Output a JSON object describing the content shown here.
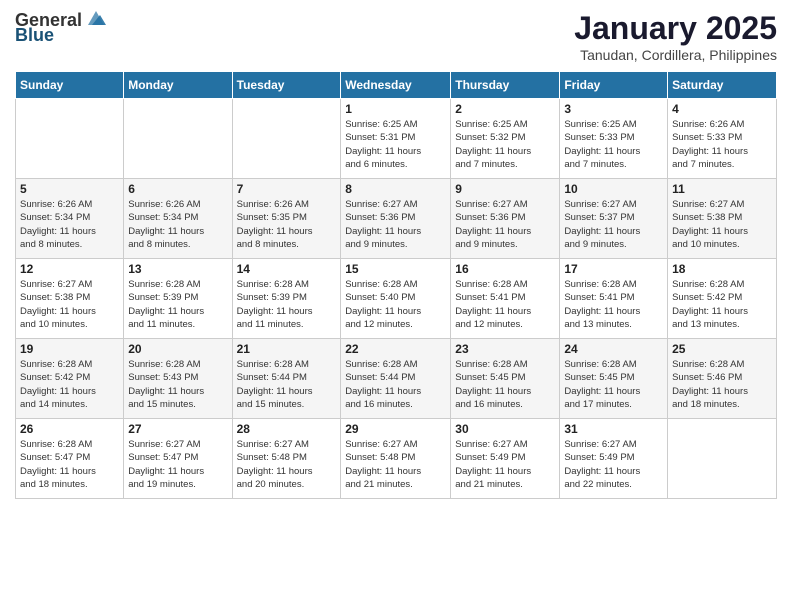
{
  "logo": {
    "general": "General",
    "blue": "Blue"
  },
  "title": {
    "month": "January 2025",
    "location": "Tanudan, Cordillera, Philippines"
  },
  "weekdays": [
    "Sunday",
    "Monday",
    "Tuesday",
    "Wednesday",
    "Thursday",
    "Friday",
    "Saturday"
  ],
  "weeks": [
    [
      {
        "day": "",
        "info": ""
      },
      {
        "day": "",
        "info": ""
      },
      {
        "day": "",
        "info": ""
      },
      {
        "day": "1",
        "info": "Sunrise: 6:25 AM\nSunset: 5:31 PM\nDaylight: 11 hours\nand 6 minutes."
      },
      {
        "day": "2",
        "info": "Sunrise: 6:25 AM\nSunset: 5:32 PM\nDaylight: 11 hours\nand 7 minutes."
      },
      {
        "day": "3",
        "info": "Sunrise: 6:25 AM\nSunset: 5:33 PM\nDaylight: 11 hours\nand 7 minutes."
      },
      {
        "day": "4",
        "info": "Sunrise: 6:26 AM\nSunset: 5:33 PM\nDaylight: 11 hours\nand 7 minutes."
      }
    ],
    [
      {
        "day": "5",
        "info": "Sunrise: 6:26 AM\nSunset: 5:34 PM\nDaylight: 11 hours\nand 8 minutes."
      },
      {
        "day": "6",
        "info": "Sunrise: 6:26 AM\nSunset: 5:34 PM\nDaylight: 11 hours\nand 8 minutes."
      },
      {
        "day": "7",
        "info": "Sunrise: 6:26 AM\nSunset: 5:35 PM\nDaylight: 11 hours\nand 8 minutes."
      },
      {
        "day": "8",
        "info": "Sunrise: 6:27 AM\nSunset: 5:36 PM\nDaylight: 11 hours\nand 9 minutes."
      },
      {
        "day": "9",
        "info": "Sunrise: 6:27 AM\nSunset: 5:36 PM\nDaylight: 11 hours\nand 9 minutes."
      },
      {
        "day": "10",
        "info": "Sunrise: 6:27 AM\nSunset: 5:37 PM\nDaylight: 11 hours\nand 9 minutes."
      },
      {
        "day": "11",
        "info": "Sunrise: 6:27 AM\nSunset: 5:38 PM\nDaylight: 11 hours\nand 10 minutes."
      }
    ],
    [
      {
        "day": "12",
        "info": "Sunrise: 6:27 AM\nSunset: 5:38 PM\nDaylight: 11 hours\nand 10 minutes."
      },
      {
        "day": "13",
        "info": "Sunrise: 6:28 AM\nSunset: 5:39 PM\nDaylight: 11 hours\nand 11 minutes."
      },
      {
        "day": "14",
        "info": "Sunrise: 6:28 AM\nSunset: 5:39 PM\nDaylight: 11 hours\nand 11 minutes."
      },
      {
        "day": "15",
        "info": "Sunrise: 6:28 AM\nSunset: 5:40 PM\nDaylight: 11 hours\nand 12 minutes."
      },
      {
        "day": "16",
        "info": "Sunrise: 6:28 AM\nSunset: 5:41 PM\nDaylight: 11 hours\nand 12 minutes."
      },
      {
        "day": "17",
        "info": "Sunrise: 6:28 AM\nSunset: 5:41 PM\nDaylight: 11 hours\nand 13 minutes."
      },
      {
        "day": "18",
        "info": "Sunrise: 6:28 AM\nSunset: 5:42 PM\nDaylight: 11 hours\nand 13 minutes."
      }
    ],
    [
      {
        "day": "19",
        "info": "Sunrise: 6:28 AM\nSunset: 5:42 PM\nDaylight: 11 hours\nand 14 minutes."
      },
      {
        "day": "20",
        "info": "Sunrise: 6:28 AM\nSunset: 5:43 PM\nDaylight: 11 hours\nand 15 minutes."
      },
      {
        "day": "21",
        "info": "Sunrise: 6:28 AM\nSunset: 5:44 PM\nDaylight: 11 hours\nand 15 minutes."
      },
      {
        "day": "22",
        "info": "Sunrise: 6:28 AM\nSunset: 5:44 PM\nDaylight: 11 hours\nand 16 minutes."
      },
      {
        "day": "23",
        "info": "Sunrise: 6:28 AM\nSunset: 5:45 PM\nDaylight: 11 hours\nand 16 minutes."
      },
      {
        "day": "24",
        "info": "Sunrise: 6:28 AM\nSunset: 5:45 PM\nDaylight: 11 hours\nand 17 minutes."
      },
      {
        "day": "25",
        "info": "Sunrise: 6:28 AM\nSunset: 5:46 PM\nDaylight: 11 hours\nand 18 minutes."
      }
    ],
    [
      {
        "day": "26",
        "info": "Sunrise: 6:28 AM\nSunset: 5:47 PM\nDaylight: 11 hours\nand 18 minutes."
      },
      {
        "day": "27",
        "info": "Sunrise: 6:27 AM\nSunset: 5:47 PM\nDaylight: 11 hours\nand 19 minutes."
      },
      {
        "day": "28",
        "info": "Sunrise: 6:27 AM\nSunset: 5:48 PM\nDaylight: 11 hours\nand 20 minutes."
      },
      {
        "day": "29",
        "info": "Sunrise: 6:27 AM\nSunset: 5:48 PM\nDaylight: 11 hours\nand 21 minutes."
      },
      {
        "day": "30",
        "info": "Sunrise: 6:27 AM\nSunset: 5:49 PM\nDaylight: 11 hours\nand 21 minutes."
      },
      {
        "day": "31",
        "info": "Sunrise: 6:27 AM\nSunset: 5:49 PM\nDaylight: 11 hours\nand 22 minutes."
      },
      {
        "day": "",
        "info": ""
      }
    ]
  ]
}
